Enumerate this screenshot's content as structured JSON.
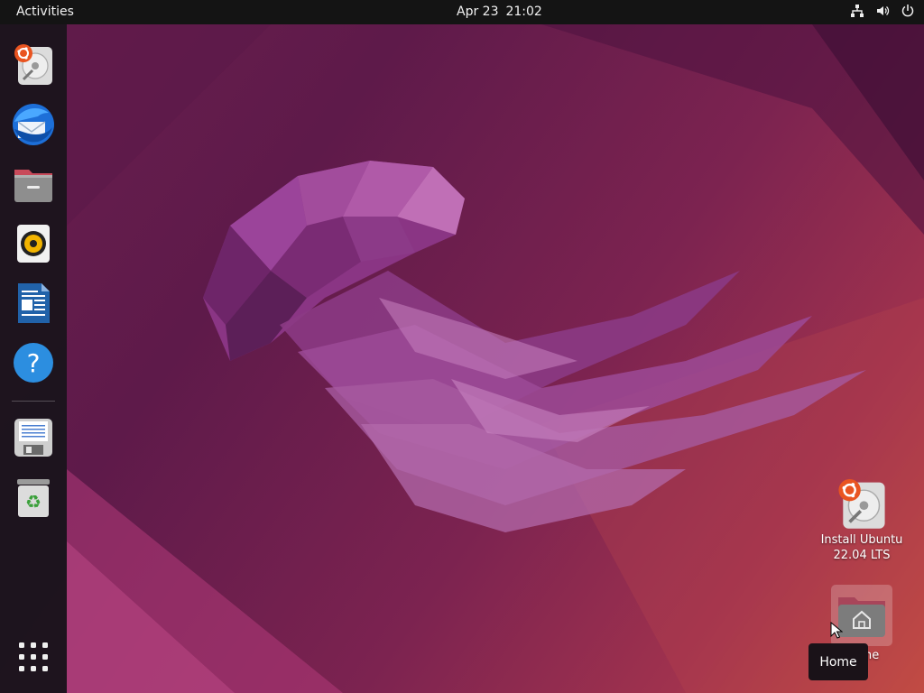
{
  "topbar": {
    "activities": "Activities",
    "date": "Apr 23",
    "time": "21:02",
    "tray": [
      "network-icon",
      "volume-icon",
      "power-icon"
    ]
  },
  "dock": {
    "items": [
      {
        "name": "install-ubuntu",
        "icon": "installer-icon"
      },
      {
        "name": "thunderbird",
        "icon": "thunderbird-mail-icon"
      },
      {
        "name": "files",
        "icon": "files-folder-icon"
      },
      {
        "name": "rhythmbox",
        "icon": "speaker-icon"
      },
      {
        "name": "libreoffice-writer",
        "icon": "writer-document-icon"
      },
      {
        "name": "help",
        "icon": "help-icon"
      },
      {
        "name": "usb-creator",
        "icon": "disk-save-icon"
      },
      {
        "name": "trash",
        "icon": "trash-icon"
      }
    ],
    "app_grid": "show-apps-grid-icon"
  },
  "desktop": {
    "install_label_line1": "Install Ubuntu",
    "install_label_line2": "22.04 LTS",
    "home_label": "Home"
  },
  "tooltip": {
    "text": "Home"
  },
  "colors": {
    "topbar": "#141414",
    "dock": "#18141a",
    "accent": "#e95420",
    "jellyfish": "#8e3a86"
  }
}
